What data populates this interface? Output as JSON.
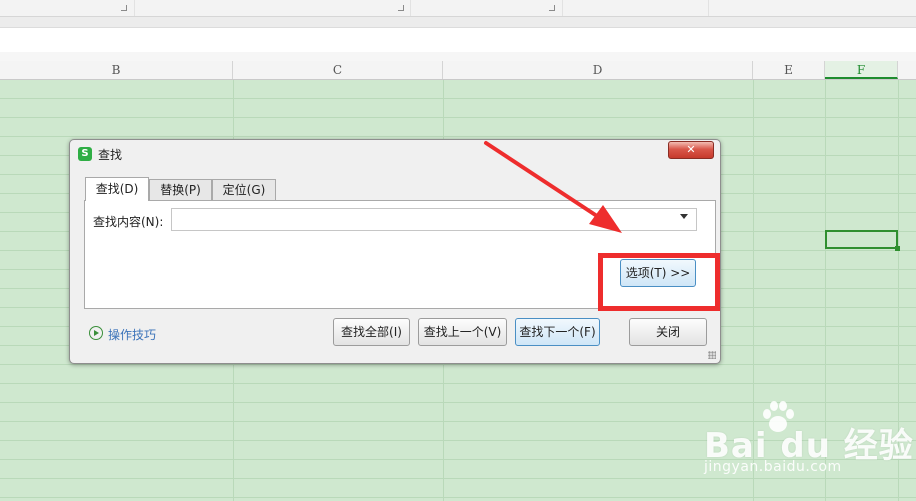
{
  "spreadsheet": {
    "columns": [
      {
        "label": "B"
      },
      {
        "label": "C"
      },
      {
        "label": "D"
      },
      {
        "label": "E"
      },
      {
        "label": "F",
        "active": true
      }
    ],
    "grid_color": "#cfe8cf",
    "selection_color": "#2f8f2f"
  },
  "dialog": {
    "icon_glyph": "S",
    "icon_color": "#2fae45",
    "title": "查找",
    "close_icon": "close-icon",
    "tabs": [
      {
        "label": "查找(D)",
        "active": true
      },
      {
        "label": "替换(P)",
        "active": false
      },
      {
        "label": "定位(G)",
        "active": false
      }
    ],
    "find_label": "查找内容(N):",
    "find_value": "",
    "options_button": "选项(T) >>",
    "tips_label": "操作技巧",
    "buttons": {
      "find_all": "查找全部(I)",
      "find_prev": "查找上一个(V)",
      "find_next": "查找下一个(F)",
      "close": "关闭"
    }
  },
  "annotation": {
    "highlight_color": "#ee2d2d"
  },
  "watermark": {
    "brand": "Bai du 经验",
    "url": "jingyan.baidu.com"
  }
}
